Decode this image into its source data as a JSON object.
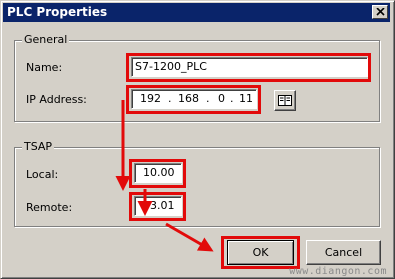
{
  "window": {
    "title": "PLC Properties"
  },
  "icons": {
    "close": "close-icon",
    "browse": "browse-icon"
  },
  "general": {
    "label": "General",
    "name_label": "Name:",
    "name_value": "S7-1200_PLC",
    "ip_label": "IP Address:",
    "ip_octets": [
      "192",
      "168",
      "0",
      "11"
    ]
  },
  "tsap": {
    "label": "TSAP",
    "local_label": "Local:",
    "local_value": "10.00",
    "remote_label": "Remote:",
    "remote_value": "03.01"
  },
  "buttons": {
    "ok": "OK",
    "cancel": "Cancel"
  },
  "watermark": "www.diangon.com",
  "colors": {
    "highlight": "#e20a0a",
    "titlebar": "#0a246a",
    "face": "#d4d0c8"
  }
}
